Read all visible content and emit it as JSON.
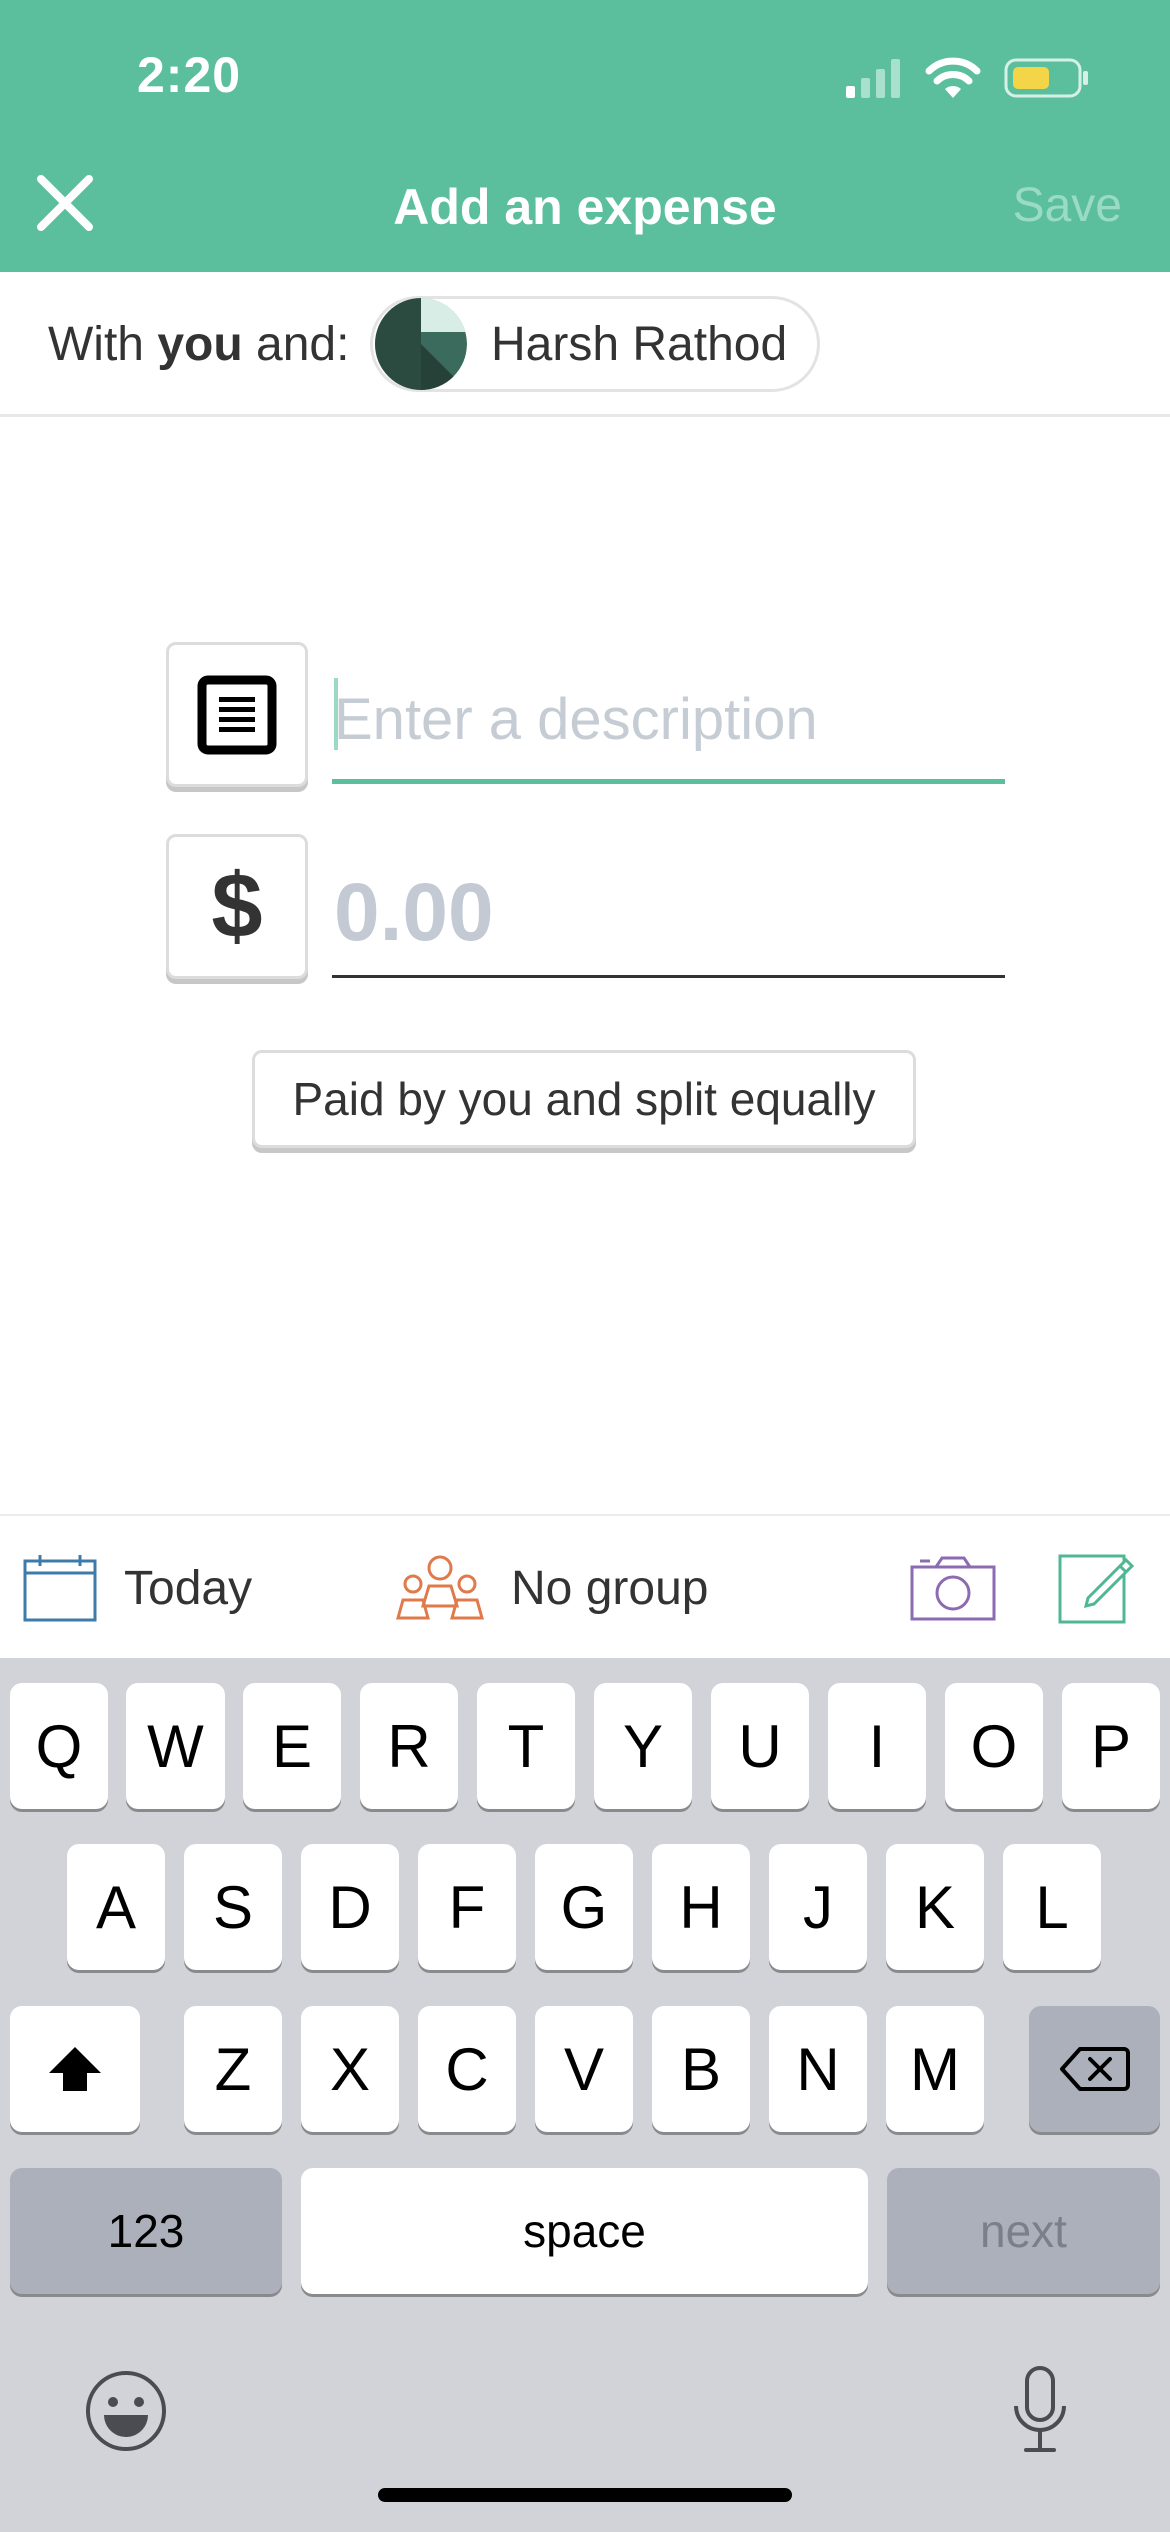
{
  "status_bar": {
    "time": "2:20"
  },
  "header": {
    "title": "Add an expense",
    "save_label": "Save",
    "background": "#5bbf9e"
  },
  "with_row": {
    "prefix": "With ",
    "you": "you",
    "suffix": " and:",
    "person_name": "Harsh Rathod"
  },
  "form": {
    "description_placeholder": "Enter a description",
    "amount_symbol": "$",
    "amount_placeholder": "0.00",
    "split_label": "Paid by you and split equally"
  },
  "toolbar": {
    "date_label": "Today",
    "group_label": "No group"
  },
  "keyboard": {
    "row1": [
      "Q",
      "W",
      "E",
      "R",
      "T",
      "Y",
      "U",
      "I",
      "O",
      "P"
    ],
    "row2": [
      "A",
      "S",
      "D",
      "F",
      "G",
      "H",
      "J",
      "K",
      "L"
    ],
    "row3": [
      "Z",
      "X",
      "C",
      "V",
      "B",
      "N",
      "M"
    ],
    "numbers_label": "123",
    "space_label": "space",
    "next_label": "next"
  }
}
